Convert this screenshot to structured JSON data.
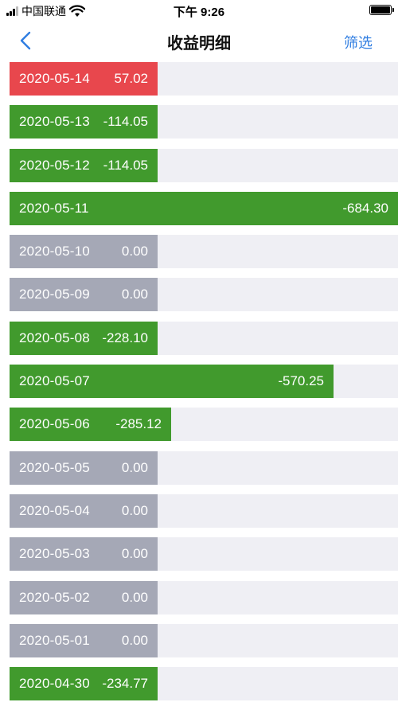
{
  "status_bar": {
    "carrier": "中国联通",
    "time": "下午 9:26"
  },
  "header": {
    "title": "收益明细",
    "filter_label": "筛选"
  },
  "colors": {
    "positive": "#e8474d",
    "negative": "#419a2d",
    "zero": "#a5a8b6",
    "track": "#efeff4",
    "accent": "#2f7de1"
  },
  "rows": [
    {
      "date": "2020-05-14",
      "value": "57.02"
    },
    {
      "date": "2020-05-13",
      "value": "-114.05"
    },
    {
      "date": "2020-05-12",
      "value": "-114.05"
    },
    {
      "date": "2020-05-11",
      "value": "-684.30"
    },
    {
      "date": "2020-05-10",
      "value": "0.00"
    },
    {
      "date": "2020-05-09",
      "value": "0.00"
    },
    {
      "date": "2020-05-08",
      "value": "-228.10"
    },
    {
      "date": "2020-05-07",
      "value": "-570.25"
    },
    {
      "date": "2020-05-06",
      "value": "-285.12"
    },
    {
      "date": "2020-05-05",
      "value": "0.00"
    },
    {
      "date": "2020-05-04",
      "value": "0.00"
    },
    {
      "date": "2020-05-03",
      "value": "0.00"
    },
    {
      "date": "2020-05-02",
      "value": "0.00"
    },
    {
      "date": "2020-05-01",
      "value": "0.00"
    },
    {
      "date": "2020-04-30",
      "value": "-234.77"
    }
  ]
}
